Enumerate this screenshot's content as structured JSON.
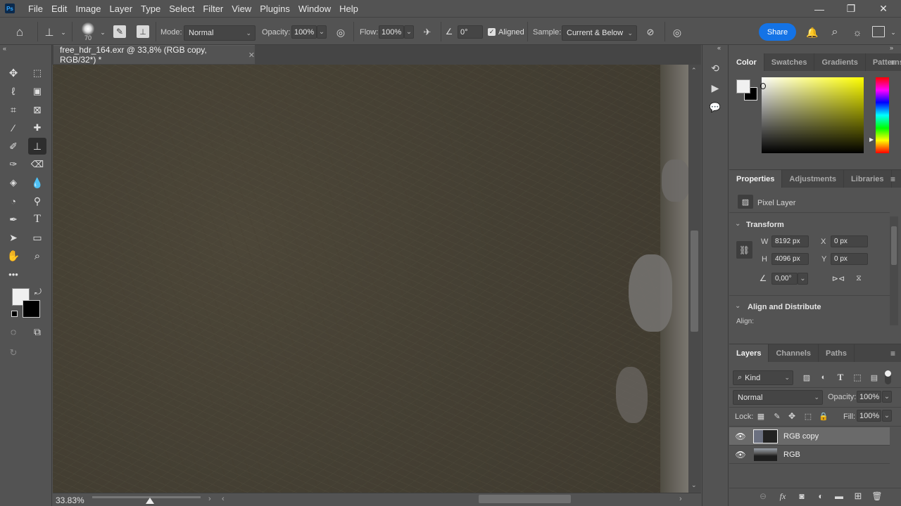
{
  "app": {
    "logo": "Ps"
  },
  "menu": [
    "File",
    "Edit",
    "Image",
    "Layer",
    "Type",
    "Select",
    "Filter",
    "View",
    "Plugins",
    "Window",
    "Help"
  ],
  "window_controls": {
    "minimize": "—",
    "restore": "❐",
    "close": "✕"
  },
  "options_bar": {
    "brush_size": "70",
    "mode_label": "Mode:",
    "mode_value": "Normal",
    "opacity_label": "Opacity:",
    "opacity_value": "100%",
    "flow_label": "Flow:",
    "flow_value": "100%",
    "angle_value": "0°",
    "aligned_label": "Aligned",
    "aligned_checked": true,
    "sample_label": "Sample:",
    "sample_value": "Current & Below",
    "share_label": "Share",
    "share_color": "#1473e6"
  },
  "document": {
    "tab_title": "free_hdr_164.exr @ 33,8% (RGB copy, RGB/32*) *",
    "zoom": "33.83%"
  },
  "toolbox": {
    "foreground_color": "#f0f0f0",
    "background_color": "#000000"
  },
  "color_panel": {
    "tabs": [
      "Color",
      "Swatches",
      "Gradients",
      "Patterns"
    ],
    "active_tab": "Color",
    "hue_color": "#ffff00"
  },
  "properties_panel": {
    "tabs": [
      "Properties",
      "Adjustments",
      "Libraries"
    ],
    "active_tab": "Properties",
    "layer_type": "Pixel Layer",
    "transform_title": "Transform",
    "w_label": "W",
    "w_value": "8192 px",
    "h_label": "H",
    "h_value": "4096 px",
    "x_label": "X",
    "x_value": "0 px",
    "y_label": "Y",
    "y_value": "0 px",
    "angle_value": "0,00°",
    "align_title": "Align and Distribute",
    "align_label": "Align:"
  },
  "layers_panel": {
    "tabs": [
      "Layers",
      "Channels",
      "Paths"
    ],
    "active_tab": "Layers",
    "filter_kind": "Kind",
    "blend_mode": "Normal",
    "opacity_label": "Opacity:",
    "opacity_value": "100%",
    "lock_label": "Lock:",
    "fill_label": "Fill:",
    "fill_value": "100%",
    "layers": [
      {
        "name": "RGB copy",
        "visible": true,
        "selected": true
      },
      {
        "name": "RGB",
        "visible": true,
        "selected": false
      }
    ]
  }
}
